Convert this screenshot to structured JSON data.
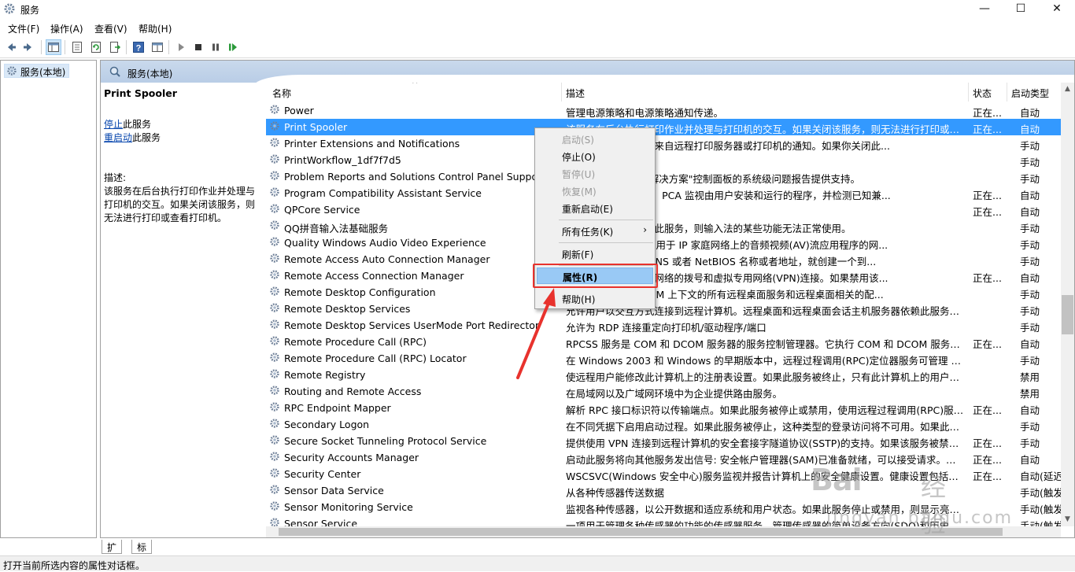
{
  "window": {
    "title": "服务",
    "min": "—",
    "max": "☐",
    "close": "✕"
  },
  "menu": [
    "文件(F)",
    "操作(A)",
    "查看(V)",
    "帮助(H)"
  ],
  "tree": {
    "item": "服务(本地)"
  },
  "pane": {
    "header": "服务(本地)"
  },
  "detail": {
    "title": "Print Spooler",
    "stop_link": "停止",
    "stop_suffix": "此服务",
    "restart_link": "重启动",
    "restart_suffix": "此服务",
    "desc_label": "描述:",
    "desc": "该服务在后台执行打印作业并处理与打印机的交互。如果关闭该服务，则无法进行打印或查看打印机。"
  },
  "columns": {
    "name": "名称",
    "desc": "描述",
    "status": "状态",
    "start": "启动类型"
  },
  "services": [
    {
      "name": "Power",
      "desc": "管理电源策略和电源策略通知传递。",
      "status": "正在...",
      "start": "自动"
    },
    {
      "name": "Print Spooler",
      "desc": "该服务在后台执行打印作业并处理与打印机的交互。如果关闭该服务，则无法进行打印或查看...",
      "status": "正在...",
      "start": "自动"
    },
    {
      "name": "Printer Extensions and Notifications",
      "desc": "打印机对话框并处理来自远程打印服务器或打印机的通知。如果你关闭此...",
      "status": "",
      "start": "手动"
    },
    {
      "name": "PrintWorkflow_1df7f7d5",
      "desc": "",
      "status": "",
      "start": "手动"
    },
    {
      "name": "Problem Reports and Solutions Control Panel Support",
      "desc": "和删除\"问题报告和解决方案\"控制面板的系统级问题报告提供支持。",
      "status": "",
      "start": "手动"
    },
    {
      "name": "Program Compatibility Assistant Service",
      "desc": "助手(PCA)提供支持。PCA 监视由用户安装和运行的程序，并检测已知兼...",
      "status": "正在...",
      "start": "自动"
    },
    {
      "name": "QPCore Service",
      "desc": "",
      "status": "正在...",
      "start": "自动"
    },
    {
      "name": "QQ拼音输入法基础服务",
      "desc": "基础服务，如果禁用此服务，则输入法的某些功能无法正常使用。",
      "status": "",
      "start": "手动"
    },
    {
      "name": "Quality Windows Audio Video Experience",
      "desc": "视频体验(qWave)是用于 IP 家庭网络上的音频视频(AV)流应用程序的网...",
      "status": "",
      "start": "手动"
    },
    {
      "name": "Remote Access Auto Connection Manager",
      "desc": "程序引用一个远程 DNS 或者 NetBIOS 名称或者地址，就创建一个到...",
      "status": "",
      "start": "手动"
    },
    {
      "name": "Remote Access Connection Manager",
      "desc": "nternet 或其他远程网络的拨号和虚拟专用网络(VPN)连接。如果禁用该...",
      "status": "正在...",
      "start": "自动"
    },
    {
      "name": "Remote Desktop Configuration",
      "desc": "CS)负责需要 SYSTEM 上下文的所有远程桌面服务和远程桌面相关的配...",
      "status": "",
      "start": "手动"
    },
    {
      "name": "Remote Desktop Services",
      "desc": "允许用户以交互方式连接到远程计算机。远程桌面和远程桌面会话主机服务器依赖此服务。若...",
      "status": "",
      "start": "手动"
    },
    {
      "name": "Remote Desktop Services UserMode Port Redirector",
      "desc": "允许为 RDP 连接重定向打印机/驱动程序/端口",
      "status": "",
      "start": "手动"
    },
    {
      "name": "Remote Procedure Call (RPC)",
      "desc": "RPCSS 服务是 COM 和 DCOM 服务器的服务控制管理器。它执行 COM 和 DCOM 服务器...",
      "status": "正在...",
      "start": "自动"
    },
    {
      "name": "Remote Procedure Call (RPC) Locator",
      "desc": "在 Windows 2003 和 Windows 的早期版本中，远程过程调用(RPC)定位器服务可管理 RPC ...",
      "status": "",
      "start": "手动"
    },
    {
      "name": "Remote Registry",
      "desc": "使远程用户能修改此计算机上的注册表设置。如果此服务被终止，只有此计算机上的用户才能...",
      "status": "",
      "start": "禁用"
    },
    {
      "name": "Routing and Remote Access",
      "desc": "在局域网以及广域网环境中为企业提供路由服务。",
      "status": "",
      "start": "禁用"
    },
    {
      "name": "RPC Endpoint Mapper",
      "desc": "解析 RPC 接口标识符以传输端点。如果此服务被停止或禁用，使用远程过程调用(RPC)服务的...",
      "status": "正在...",
      "start": "自动"
    },
    {
      "name": "Secondary Logon",
      "desc": "在不同凭据下启用启动过程。如果此服务被停止，这种类型的登录访问将不可用。如果此服务...",
      "status": "",
      "start": "手动"
    },
    {
      "name": "Secure Socket Tunneling Protocol Service",
      "desc": "提供使用 VPN 连接到远程计算机的安全套接字隧道协议(SSTP)的支持。如果该服务被禁用，...",
      "status": "正在...",
      "start": "手动"
    },
    {
      "name": "Security Accounts Manager",
      "desc": "启动此服务将向其他服务发出信号: 安全帐户管理器(SAM)已准备就绪，可以接受请求。禁用...",
      "status": "正在...",
      "start": "自动"
    },
    {
      "name": "Security Center",
      "desc": "WSCSVC(Windows 安全中心)服务监视并报告计算机上的安全健康设置。健康设置包括防火...",
      "status": "正在...",
      "start": "自动(延迟..."
    },
    {
      "name": "Sensor Data Service",
      "desc": "从各种传感器传送数据",
      "status": "",
      "start": "手动(触发..."
    },
    {
      "name": "Sensor Monitoring Service",
      "desc": "监视各种传感器，以公开数据和适应系统和用户状态。如果此服务停止或禁用，则显示亮度将...",
      "status": "",
      "start": "手动(触发..."
    },
    {
      "name": "Sensor Service",
      "desc": "一项用于管理各种传感器的功能的传感器服务。管理传感器的简单设备方向(SDO)和历史记录...",
      "status": "",
      "start": "手动(触发..."
    }
  ],
  "selected_index": 1,
  "context_menu": {
    "start": "启动(S)",
    "stop": "停止(O)",
    "pause": "暂停(U)",
    "resume": "恢复(M)",
    "restart": "重新启动(E)",
    "all_tasks": "所有任务(K)",
    "refresh": "刷新(F)",
    "properties": "属性(R)",
    "help": "帮助(H)"
  },
  "tabs": [
    "扩展",
    "标准"
  ],
  "status_bar": "打开当前所选内容的属性对话框。",
  "watermark": {
    "logo": "Bai",
    "cn": "经验",
    "url": "jingyan.baidu.com"
  },
  "colors": {
    "selection": "#3399ff",
    "annotation_red": "#e8322d",
    "menu_highlight": "#99c9f5"
  },
  "icons": {
    "app": "gear-icon",
    "service": "gear-icon",
    "back": "back-arrow-icon",
    "forward": "forward-arrow-icon",
    "play": "play-icon",
    "stop": "stop-icon",
    "pause": "pause-icon",
    "restart": "restart-icon",
    "help": "help-icon",
    "refresh": "refresh-icon",
    "export": "export-icon"
  }
}
